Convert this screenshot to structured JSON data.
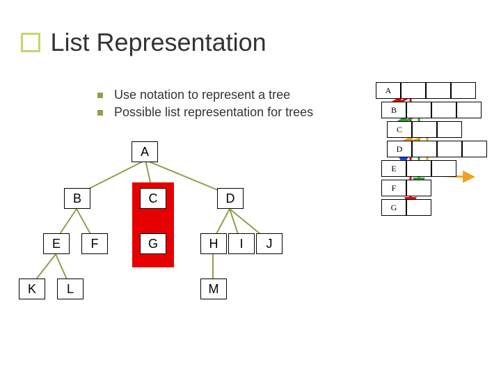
{
  "title": "List Representation",
  "bullets": [
    "Use notation to represent a tree",
    "Possible list representation for trees"
  ],
  "tree": {
    "A": "A",
    "B": "B",
    "C": "C",
    "D": "D",
    "E": "E",
    "F": "F",
    "G": "G",
    "H": "H",
    "I": "I",
    "J": "J",
    "K": "K",
    "L": "L",
    "M": "M"
  },
  "listcells": {
    "r0": "A",
    "r1": "B",
    "r2": "C",
    "r3": "D",
    "r4": "E",
    "r5": "F",
    "r6": "G"
  }
}
